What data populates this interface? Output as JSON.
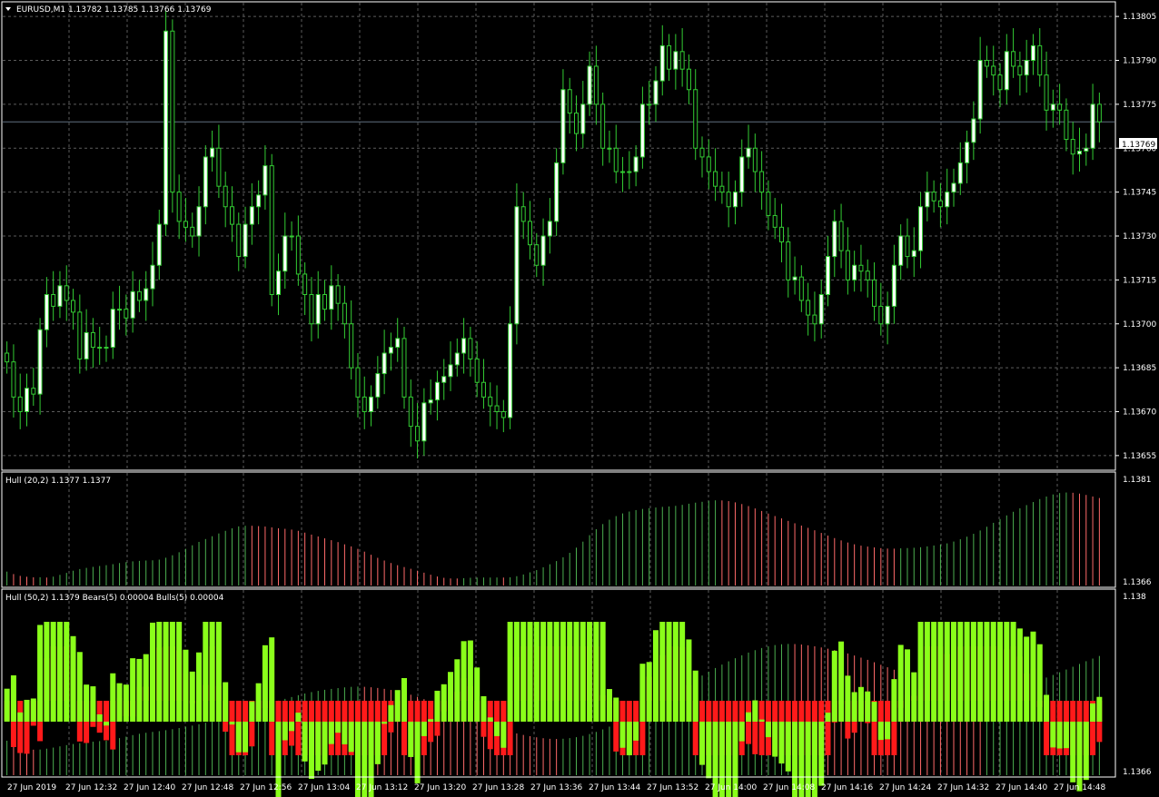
{
  "colors": {
    "background": "#000000",
    "grid": "#5c5c5c",
    "frame": "#ffffff",
    "text": "#ffffff",
    "bull_candle": "#ffffff",
    "bear_candle": "#000000",
    "candle_outline": "#33cc33",
    "bid_line": "#607080",
    "bid_box": "#ffffff",
    "hull_up": "#4caf50",
    "hull_down": "#ff6a6a",
    "bulls": "#8aff1a",
    "bears": "#ff1a1a"
  },
  "main": {
    "dropdown_icon": "triangle-down-icon",
    "title": "EURUSD,M1  1.13782 1.13785 1.13766 1.13769",
    "bid_label": "1.13769",
    "price_ticks": [
      "1.13805",
      "1.13790",
      "1.13775",
      "1.13760",
      "1.13745",
      "1.13730",
      "1.13715",
      "1.13700",
      "1.13685",
      "1.13670",
      "1.13655"
    ]
  },
  "sub1": {
    "title": "Hull (20,2) 1.1377 1.1377",
    "ticks": [
      "1.1381",
      "1.1366"
    ]
  },
  "sub2": {
    "title": "Hull (50,2) 1.1379  Bears(5) 0.00004  Bulls(5) 0.00004",
    "ticks": [
      "1.138",
      "1.1366"
    ]
  },
  "time_labels": [
    "27 Jun 2019",
    "27 Jun 12:32",
    "27 Jun 12:40",
    "27 Jun 12:48",
    "27 Jun 12:56",
    "27 Jun 13:04",
    "27 Jun 13:12",
    "27 Jun 13:20",
    "27 Jun 13:28",
    "27 Jun 13:36",
    "27 Jun 13:44",
    "27 Jun 13:52",
    "27 Jun 14:00",
    "27 Jun 14:08",
    "27 Jun 14:16",
    "27 Jun 14:24",
    "27 Jun 14:32",
    "27 Jun 14:40",
    "27 Jun 14:48"
  ],
  "chart_data": [
    {
      "type": "candlestick",
      "title": "EURUSD,M1",
      "ylim": [
        1.1365,
        1.1381
      ],
      "grid": true,
      "last": {
        "open": 1.13782,
        "high": 1.13785,
        "low": 1.13766,
        "close": 1.13769
      },
      "close": [
        1.13687,
        1.13675,
        1.1367,
        1.13678,
        1.13676,
        1.13698,
        1.1371,
        1.13706,
        1.13713,
        1.13708,
        1.13704,
        1.13688,
        1.13697,
        1.13692,
        1.13692,
        1.13692,
        1.13705,
        1.13705,
        1.13702,
        1.13711,
        1.13708,
        1.13712,
        1.1372,
        1.13734,
        1.138,
        1.13745,
        1.13735,
        1.13733,
        1.1373,
        1.1374,
        1.13757,
        1.1376,
        1.13747,
        1.1374,
        1.13734,
        1.13723,
        1.13734,
        1.1374,
        1.13744,
        1.13754,
        1.1371,
        1.13718,
        1.1373,
        1.1373,
        1.13717,
        1.1371,
        1.137,
        1.1371,
        1.13705,
        1.13713,
        1.13707,
        1.137,
        1.13685,
        1.13675,
        1.1367,
        1.13675,
        1.13683,
        1.1369,
        1.13692,
        1.13695,
        1.13675,
        1.13665,
        1.1366,
        1.13673,
        1.13674,
        1.1368,
        1.13682,
        1.13686,
        1.1369,
        1.13695,
        1.13688,
        1.1368,
        1.13675,
        1.13672,
        1.1367,
        1.13668,
        1.137,
        1.1374,
        1.13735,
        1.13727,
        1.1372,
        1.1373,
        1.13735,
        1.13755,
        1.1378,
        1.13772,
        1.13765,
        1.13775,
        1.13788,
        1.13775,
        1.1376,
        1.1376,
        1.13752,
        1.13752,
        1.13752,
        1.13757,
        1.13775,
        1.13775,
        1.13783,
        1.13795,
        1.13787,
        1.13793,
        1.13787,
        1.1378,
        1.1376,
        1.13757,
        1.13752,
        1.13747,
        1.13745,
        1.1374,
        1.13745,
        1.13757,
        1.1376,
        1.13752,
        1.13745,
        1.13737,
        1.13733,
        1.13728,
        1.13715,
        1.13716,
        1.13708,
        1.13703,
        1.137,
        1.1371,
        1.13723,
        1.13735,
        1.13725,
        1.13715,
        1.1372,
        1.13718,
        1.13715,
        1.13706,
        1.137,
        1.13706,
        1.1372,
        1.1373,
        1.13723,
        1.13725,
        1.1374,
        1.13745,
        1.13742,
        1.1374,
        1.13745,
        1.13748,
        1.13755,
        1.13762,
        1.1377,
        1.1379,
        1.13788,
        1.13785,
        1.1378,
        1.13793,
        1.13788,
        1.13785,
        1.1379,
        1.13795,
        1.13785,
        1.13773,
        1.13775,
        1.13773,
        1.13763,
        1.13758,
        1.13759,
        1.1376,
        1.13775,
        1.13769
      ]
    },
    {
      "type": "bar",
      "title": "Hull (20,2)",
      "ylim": [
        1.1366,
        1.1381
      ],
      "series": [
        {
          "name": "Hull (20,2)",
          "last": 1.1377
        }
      ],
      "values_up_down": "green rising / red falling"
    },
    {
      "type": "bar",
      "title": "Hull (50,2), Bears(5), Bulls(5)",
      "ylim": [
        1.1366,
        1.138
      ],
      "series": [
        {
          "name": "Hull (50,2)",
          "last": 1.1379
        },
        {
          "name": "Bears(5)",
          "last": 4e-05
        },
        {
          "name": "Bulls(5)",
          "last": 4e-05
        }
      ]
    }
  ]
}
